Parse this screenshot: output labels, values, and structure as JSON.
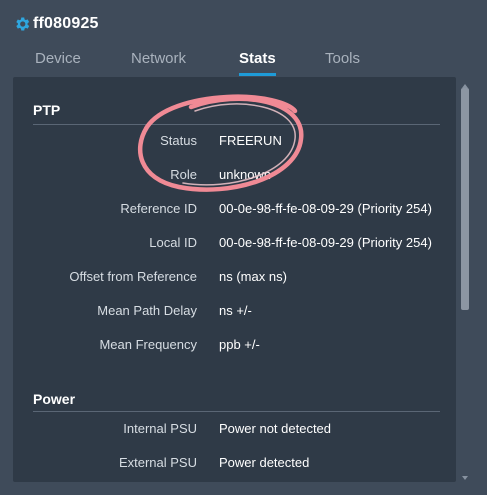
{
  "header": {
    "title": "ff080925",
    "icon": "gear-icon"
  },
  "tabs": [
    {
      "label": "Device",
      "active": false
    },
    {
      "label": "Network",
      "active": false
    },
    {
      "label": "Stats",
      "active": true
    },
    {
      "label": "Tools",
      "active": false
    }
  ],
  "ptp": {
    "title": "PTP",
    "status": {
      "label": "Status",
      "value": "FREERUN"
    },
    "role": {
      "label": "Role",
      "value": "unknown"
    },
    "reference_id": {
      "label": "Reference ID",
      "value": "00-0e-98-ff-fe-08-09-29 (Priority 254)"
    },
    "local_id": {
      "label": "Local ID",
      "value": "00-0e-98-ff-fe-08-09-29 (Priority 254)"
    },
    "offset": {
      "label": "Offset from Reference",
      "value": "ns (max ns)"
    },
    "mean_path_delay": {
      "label": "Mean Path Delay",
      "value": "ns +/-"
    },
    "mean_frequency": {
      "label": "Mean Frequency",
      "value": "ppb +/-"
    }
  },
  "power": {
    "title": "Power",
    "internal_psu": {
      "label": "Internal PSU",
      "value": "Power not detected"
    },
    "external_psu": {
      "label": "External PSU",
      "value": "Power detected"
    }
  },
  "colors": {
    "accent": "#1e9bd8",
    "highlight": "#f08a95",
    "background": "#3f4b5a",
    "panel": "#2f3a47"
  }
}
